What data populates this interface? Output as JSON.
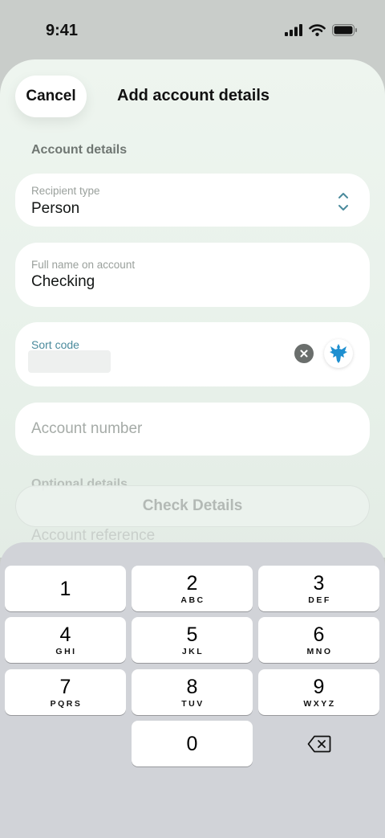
{
  "status_bar": {
    "time": "9:41"
  },
  "header": {
    "cancel_label": "Cancel",
    "title": "Add account details"
  },
  "section_title": "Account details",
  "fields": {
    "recipient_type": {
      "label": "Recipient type",
      "value": "Person"
    },
    "full_name": {
      "label": "Full name on account",
      "value": "Checking"
    },
    "sort_code": {
      "label": "Sort code",
      "value": "",
      "label_color": "#4a8a9c"
    },
    "account_number": {
      "placeholder": "Account number"
    },
    "account_reference": {
      "placeholder": "Account reference"
    }
  },
  "optional_section_title": "Optional details",
  "check_button_label": "Check Details",
  "keypad": {
    "keys": [
      {
        "digit": "1",
        "letters": ""
      },
      {
        "digit": "2",
        "letters": "ABC"
      },
      {
        "digit": "3",
        "letters": "DEF"
      },
      {
        "digit": "4",
        "letters": "GHI"
      },
      {
        "digit": "5",
        "letters": "JKL"
      },
      {
        "digit": "6",
        "letters": "MNO"
      },
      {
        "digit": "7",
        "letters": "PQRS"
      },
      {
        "digit": "8",
        "letters": "TUV"
      },
      {
        "digit": "9",
        "letters": "WXYZ"
      },
      {
        "digit": "0",
        "letters": ""
      }
    ]
  },
  "colors": {
    "accent": "#4a8a9c",
    "bank_logo": "#1e8fd0"
  }
}
